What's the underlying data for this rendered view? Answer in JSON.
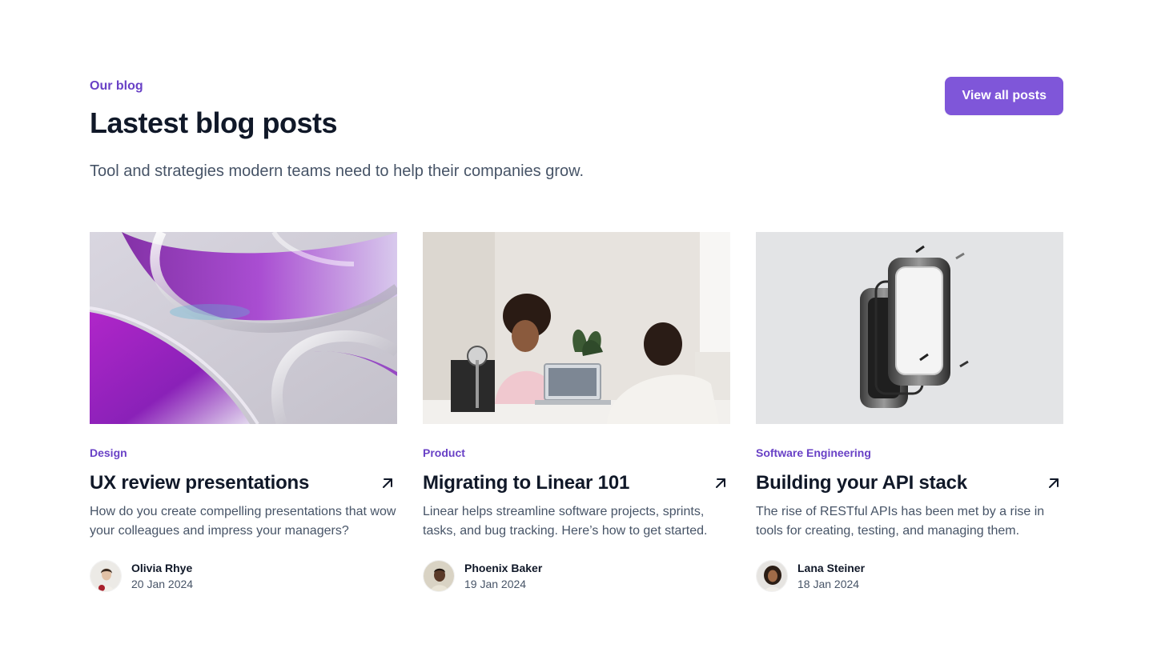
{
  "header": {
    "eyebrow": "Our blog",
    "title": "Lastest blog posts",
    "subtitle": "Tool and strategies modern teams need to help their companies grow.",
    "view_all_label": "View all posts"
  },
  "colors": {
    "accent": "#7f56d9",
    "accent_text": "#6941c6",
    "heading": "#101828",
    "body_text": "#475467"
  },
  "posts": [
    {
      "image": "abstract-glass-rings-image",
      "category": "Design",
      "title": "UX review presentations",
      "excerpt": "How do you create compelling presentations that wow your colleagues and impress your managers?",
      "author": "Olivia Rhye",
      "date": "20 Jan 2024",
      "icon": "arrow-up-right-icon"
    },
    {
      "image": "people-at-desk-image",
      "category": "Product",
      "title": "Migrating to Linear 101",
      "excerpt": "Linear helps streamline software projects, sprints, tasks, and bug tracking. Here’s how to get started.",
      "author": "Phoenix Baker",
      "date": "19 Jan 2024",
      "icon": "arrow-up-right-icon"
    },
    {
      "image": "exploded-metal-frames-image",
      "category": "Software Engineering",
      "title": "Building your API stack",
      "excerpt": "The rise of RESTful APIs has been met by a rise in tools for creating, testing, and managing them.",
      "author": "Lana Steiner",
      "date": "18 Jan 2024",
      "icon": "arrow-up-right-icon"
    }
  ]
}
